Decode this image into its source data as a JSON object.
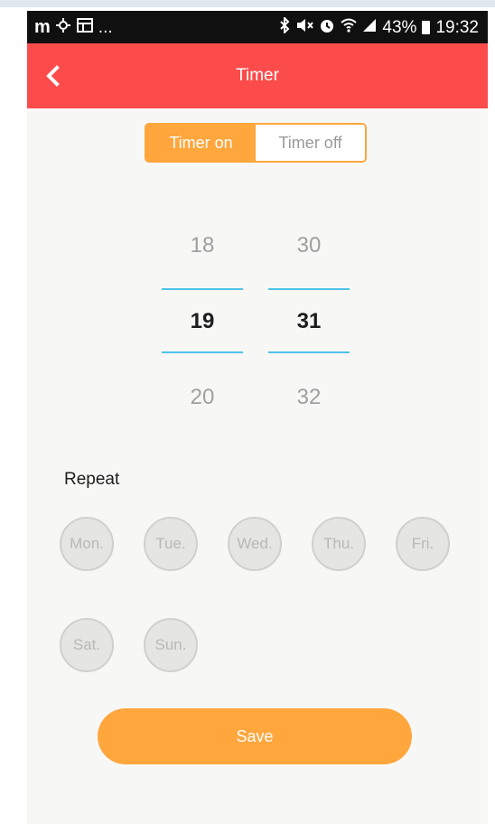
{
  "status_bar": {
    "left_brand": "m",
    "left_icons": [
      "mzone-icon",
      "settings-icon",
      "gallery-icon"
    ],
    "more": "...",
    "right_icons": [
      "bluetooth-icon",
      "mute-icon",
      "alarm-icon",
      "wifi-icon",
      "signal-icon"
    ],
    "battery": "43%",
    "time": "19:32"
  },
  "header": {
    "title": "Timer",
    "back_icon": "chevron-left-icon"
  },
  "toggle": {
    "on_label": "Timer on",
    "off_label": "Timer off",
    "selected": "on"
  },
  "picker": {
    "hours": {
      "prev": "18",
      "current": "19",
      "next": "20"
    },
    "minutes": {
      "prev": "30",
      "current": "31",
      "next": "32"
    }
  },
  "repeat": {
    "label": "Repeat",
    "days": [
      "Mon.",
      "Tue.",
      "Wed.",
      "Thu.",
      "Fri.",
      "Sat.",
      "Sun."
    ]
  },
  "save_label": "Save",
  "colors": {
    "header": "#fc4b4b",
    "accent": "#ffa63d",
    "picker_line": "#4fc3e8",
    "day_fill": "#e5e5e3"
  }
}
